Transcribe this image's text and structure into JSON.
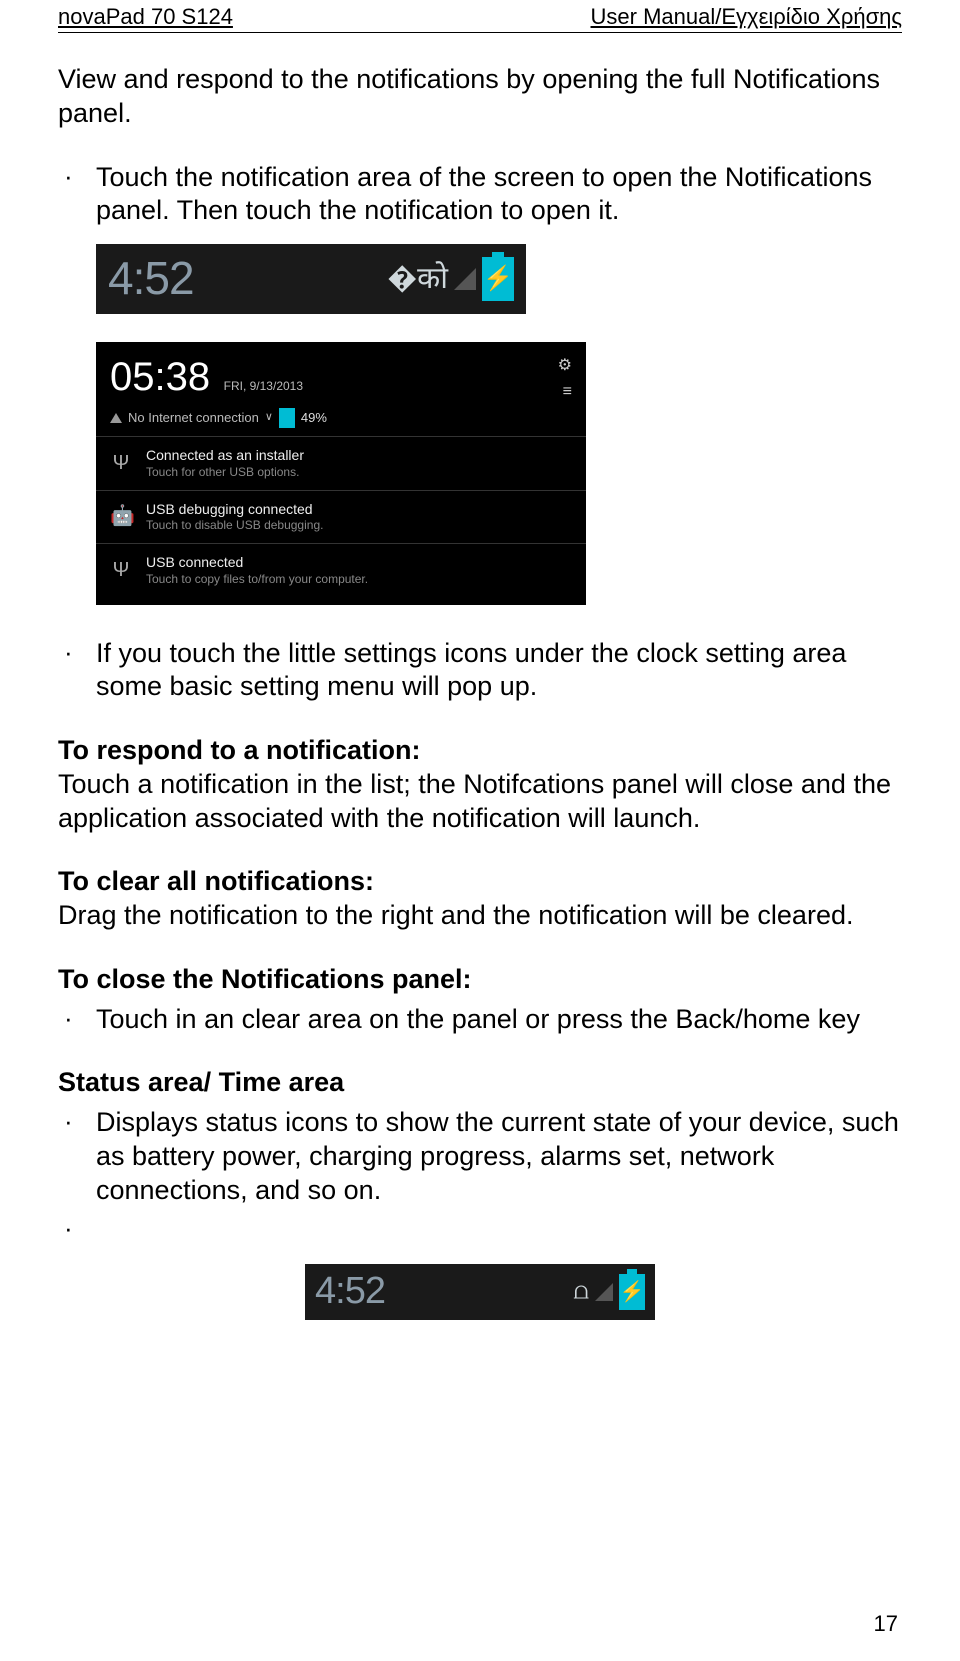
{
  "header": {
    "left": "novaPad 70 S124",
    "right": "User Manual/Εγχειρίδιο Χρήσης"
  },
  "intro": "View and respond to the notifications by opening the full Notifications panel.",
  "bullet1a": "Touch the notification area of the screen to open the Notifications panel. Then touch the notification to open it.",
  "statusbarClock": "4:52",
  "notifPanel": {
    "time": "05:38",
    "date": "FRI, 9/13/2013",
    "noInternet": "No Internet connection",
    "battPct": "49%",
    "items": [
      {
        "title": "Connected as an installer",
        "sub": "Touch for other USB options."
      },
      {
        "title": "USB debugging connected",
        "sub": "Touch to disable USB debugging."
      },
      {
        "title": "USB connected",
        "sub": "Touch to copy files to/from your computer."
      }
    ]
  },
  "bullet1b": "If you touch the little settings icons under the clock setting area some basic setting menu will pop up.",
  "respondHead": "To respond to a notification:",
  "respondBody": "Touch a notification in the list; the Notifcations panel will close and the application associated with the notification will launch.",
  "clearHead": "To clear all notifications:",
  "clearBody": "Drag the notification to the right and the notification will be cleared.",
  "closeHead": "To close the Notifications panel:",
  "closeBullet": "Touch in an clear area on the panel or press the Back/home key",
  "statusHead": "Status area/ Time area",
  "statusBullet": "Displays status icons to show the current state of your device, such as battery power, charging progress, alarms set, network connections, and so on.",
  "pageNumber": "17"
}
